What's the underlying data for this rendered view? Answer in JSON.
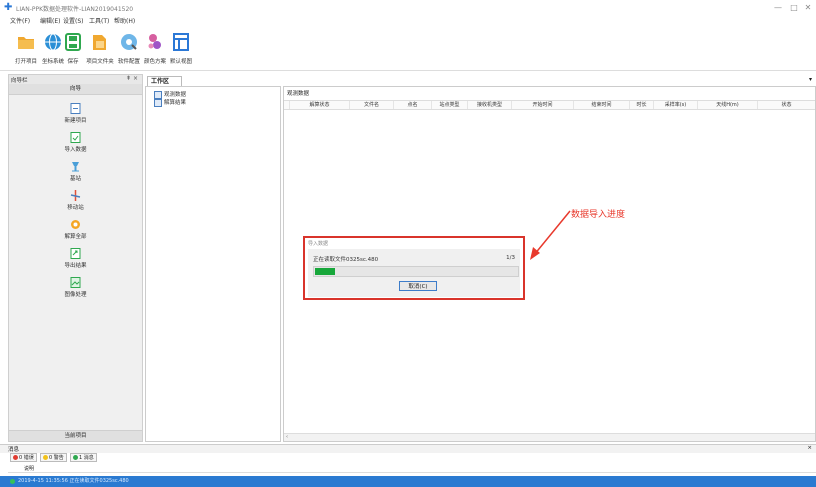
{
  "window": {
    "title": "LIAN-PPK数据处理软件-LIAN2019041520",
    "controls": [
      "—",
      "□",
      "✕"
    ]
  },
  "menu": [
    "文件(F)",
    "编辑(E)",
    "设置(S)",
    "工具(T)",
    "帮助(H)"
  ],
  "toolbar": [
    {
      "label": "打开项目",
      "icon": "open-folder-icon",
      "color": "#f0a830"
    },
    {
      "label": "坐标系统",
      "icon": "globe-icon",
      "color": "#2b8fd6"
    },
    {
      "label": "保存",
      "icon": "save-icon",
      "color": "#2fa84f"
    },
    {
      "label": "项目文件夹",
      "icon": "project-folder-icon",
      "color": "#f0a830"
    },
    {
      "label": "软件配置",
      "icon": "config-icon",
      "color": "#2b8fd6"
    },
    {
      "label": "颜色方案",
      "icon": "palette-icon",
      "color": "#d65fa0"
    },
    {
      "label": "默认视图",
      "icon": "default-view-icon",
      "color": "#2b78d6"
    }
  ],
  "left_panel": {
    "title": "向导栏",
    "pin": "⇞ ×",
    "nav_header": "向导",
    "items": [
      {
        "label": "新建项目",
        "icon": "new-project-icon"
      },
      {
        "label": "导入数据",
        "icon": "import-data-icon"
      },
      {
        "label": "基站",
        "icon": "base-station-icon"
      },
      {
        "label": "移动站",
        "icon": "rover-icon"
      },
      {
        "label": "解算全部",
        "icon": "solve-all-icon"
      },
      {
        "label": "导出结果",
        "icon": "export-results-icon"
      },
      {
        "label": "图像处理",
        "icon": "image-processing-icon"
      }
    ],
    "bottom": "当前项目"
  },
  "workspace": {
    "tab": "工作区",
    "tab_arrow": "▾",
    "tree": [
      "观测数据",
      "解算结果"
    ],
    "data_title": "观测数据",
    "columns": [
      "解算状态",
      "文件名",
      "点名",
      "站点类型",
      "接收机类型",
      "开始时间",
      "结束时间",
      "时长",
      "采样率(s)",
      "天线H(m)",
      "状态"
    ]
  },
  "dialog": {
    "title": "导入数据",
    "message": "正在读取文件0325sc.480",
    "count": "1/3",
    "progress": 0.1,
    "cancel_label": "取消(C)"
  },
  "annotation": {
    "text": "数据导入进度",
    "color": "#e8392c"
  },
  "messages": {
    "header": "消息",
    "close": "×",
    "tabs": [
      {
        "label": "0 错误",
        "color": "#e03c31"
      },
      {
        "label": "0 警告",
        "color": "#f2c21b"
      },
      {
        "label": "1 消息",
        "color": "#2fa84f"
      }
    ],
    "column": "说明",
    "status_line": "2019-4-15 11:35:56  正在读取文件0325sc.480"
  }
}
